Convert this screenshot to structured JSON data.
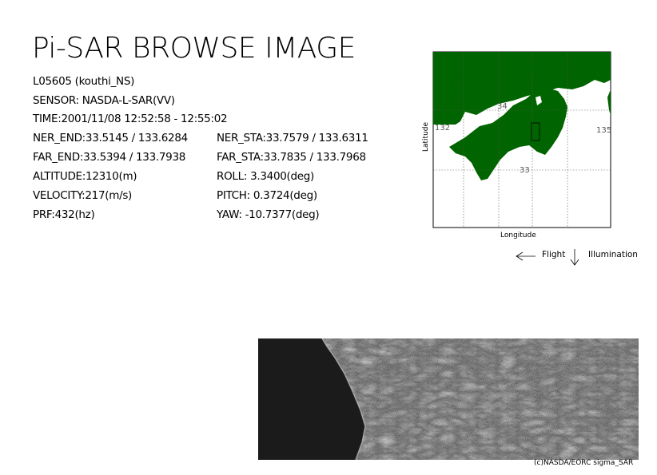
{
  "title": "Pi-SAR BROWSE IMAGE",
  "scene_id": "L05605 (kouthi_NS)",
  "sensor": "SENSOR: NASDA-L-SAR(VV)",
  "time": "TIME:2001/11/08  12:52:58 - 12:55:02",
  "ner_end": "NER_END:33.5145 / 133.6284",
  "ner_sta": "NER_STA:33.7579 / 133.6311",
  "far_end": "FAR_END:33.5394 / 133.7938",
  "far_sta": "FAR_STA:33.7835 / 133.7968",
  "altitude": "ALTITUDE:12310(m)",
  "roll": "ROLL: 3.3400(deg)",
  "velocity": "VELOCITY:217(m/s)",
  "pitch": "PITCH:  0.3724(deg)",
  "prf": "PRF:432(hz)",
  "yaw": "YAW: -10.7377(deg)",
  "map": {
    "ylabel": "Latitude",
    "xlabel": "Longitude",
    "lat_34": "34",
    "lat_33": "33",
    "lon_132": "132",
    "lon_135": "135",
    "land_color": "#006400"
  },
  "legend": {
    "flight": "Flight",
    "illumination": "Illumination"
  },
  "credit": "(c)NASDA/EORC sigma_SAR"
}
